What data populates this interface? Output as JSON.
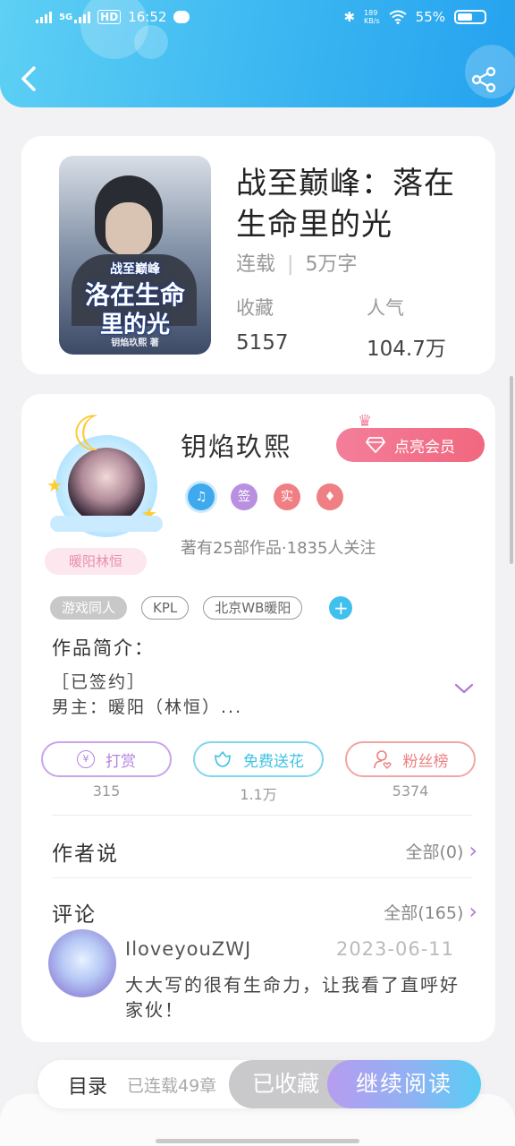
{
  "status_bar": {
    "network": "5G",
    "hd": "HD",
    "time": "16:52",
    "speed_top": "189",
    "speed_unit": "KB/s",
    "battery": "55%"
  },
  "book": {
    "title": "战至巅峰：落在生命里的光",
    "status": "连载",
    "words": "5万字",
    "favorites_label": "收藏",
    "favorites_value": "5157",
    "popularity_label": "人气",
    "popularity_value": "104.7万",
    "cover_text": {
      "series": "战至巅峰",
      "line1": "洛在生命",
      "line2": "里的光",
      "author": "钥焰玖熙 著"
    }
  },
  "author": {
    "name": "钥焰玖熙",
    "nickname_tag": "暖阳林恒",
    "vip_button": "点亮会员",
    "badges": [
      {
        "label": "♫",
        "color": "#3fa9ee"
      },
      {
        "label": "签",
        "color": "#b98fe0"
      },
      {
        "label": "实",
        "color": "#f07f83"
      },
      {
        "label": "♦",
        "color": "#f07f83"
      }
    ],
    "description": "著有25部作品·1835人关注"
  },
  "tags": [
    "游戏同人",
    "KPL",
    "北京WB暖阳"
  ],
  "intro": {
    "title": "作品简介：",
    "line1": "［已签约］",
    "line2": "男主：暖阳（林恒）..."
  },
  "actions": [
    {
      "label": "打赏",
      "count": "315",
      "color": "#b583e0"
    },
    {
      "label": "免费送花",
      "count": "1.1万",
      "color": "#3fc3e6"
    },
    {
      "label": "粉丝榜",
      "count": "5374",
      "color": "#ee7f80"
    }
  ],
  "author_says": {
    "title": "作者说",
    "more": "全部(0)"
  },
  "comments": {
    "title": "评论",
    "more": "全部(165)",
    "items": [
      {
        "user": "IloveyouZWJ",
        "date": "2023-06-11",
        "text": "大大写的很有生命力，让我看了直呼好家伙！"
      }
    ]
  },
  "bottom_bar": {
    "toc": "目录",
    "serial_count": "已连载49章",
    "collected": "已收藏",
    "continue": "继续阅读"
  }
}
